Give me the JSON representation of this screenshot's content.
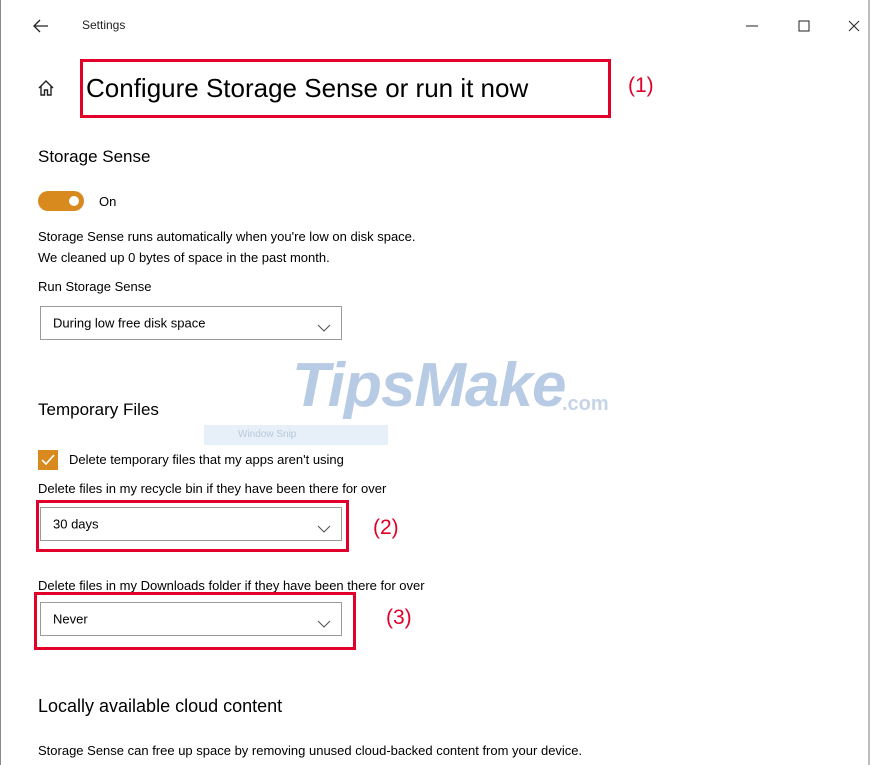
{
  "window": {
    "title": "Settings",
    "back_icon": "arrow-left-icon",
    "controls": {
      "minimize": "minimize-icon",
      "maximize": "maximize-icon",
      "close": "close-icon"
    }
  },
  "page": {
    "home_icon": "home-icon",
    "title": "Configure Storage Sense or run it now"
  },
  "annotations": {
    "label_1": "(1)",
    "label_2": "(2)",
    "label_3": "(3)",
    "color": "#e00029"
  },
  "storage_sense": {
    "heading": "Storage Sense",
    "toggle_label": "On",
    "toggle_on": true,
    "desc_line1": "Storage Sense runs automatically when you're low on disk space.",
    "desc_line2": "We cleaned up 0 bytes of space in the past month.",
    "run_label": "Run Storage Sense",
    "run_value": "During low free disk space"
  },
  "temporary_files": {
    "heading": "Temporary Files",
    "checkbox_label": "Delete temporary files that my apps aren't using",
    "checkbox_checked": true,
    "recycle_label": "Delete files in my recycle bin if they have been there for over",
    "recycle_value": "30 days",
    "downloads_label": "Delete files in my Downloads folder if they have been there for over",
    "downloads_value": "Never"
  },
  "cloud": {
    "heading": "Locally available cloud content",
    "desc": "Storage Sense can free up space by removing unused cloud-backed content from your device."
  },
  "overlay": {
    "watermark": "TipsMake",
    "watermark_suffix": ".com",
    "snip_text": "Window Snip"
  },
  "colors": {
    "accent": "#d88a1f",
    "annotation": "#e00029"
  }
}
